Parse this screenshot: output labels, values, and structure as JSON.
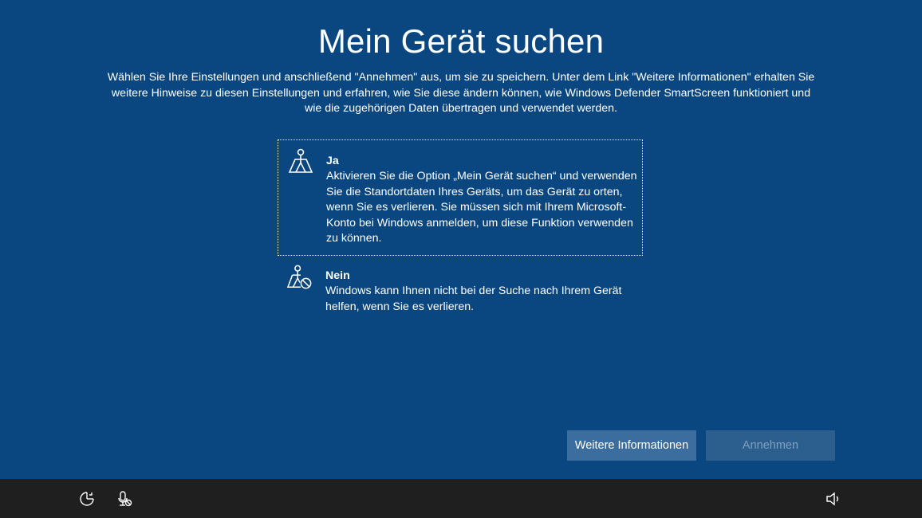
{
  "page": {
    "title": "Mein Gerät suchen",
    "intro": "Wählen Sie Ihre Einstellungen und anschließend \"Annehmen\" aus, um sie zu speichern. Unter dem Link \"Weitere Informationen\" erhalten Sie weitere Hinweise zu diesen Einstellungen und erfahren, wie Sie diese ändern können, wie Windows Defender SmartScreen funktioniert und wie die zugehörigen Daten übertragen und verwendet werden."
  },
  "options": {
    "yes": {
      "icon": "location-icon",
      "heading": "Ja",
      "description": "Aktivieren Sie die Option „Mein Gerät suchen“ und verwenden Sie die Standortdaten Ihres Geräts, um das Gerät zu orten, wenn Sie es verlieren. Sie müssen sich mit Ihrem Microsoft-Konto bei Windows anmelden, um diese Funktion verwenden zu können."
    },
    "no": {
      "icon": "location-blocked-icon",
      "heading": "Nein",
      "description": "Windows kann Ihnen nicht bei der Suche nach Ihrem Gerät helfen, wenn Sie es verlieren."
    }
  },
  "buttons": {
    "more_info": "Weitere Informationen",
    "accept": "Annehmen"
  },
  "taskbar": {
    "icons": [
      "ease-of-access-icon",
      "microphone-icon",
      "volume-icon"
    ]
  },
  "colors": {
    "background": "#0a4780",
    "taskbar": "#1f1f1f",
    "button_active": "#3b6e9e",
    "button_disabled": "#2d5f8e"
  }
}
